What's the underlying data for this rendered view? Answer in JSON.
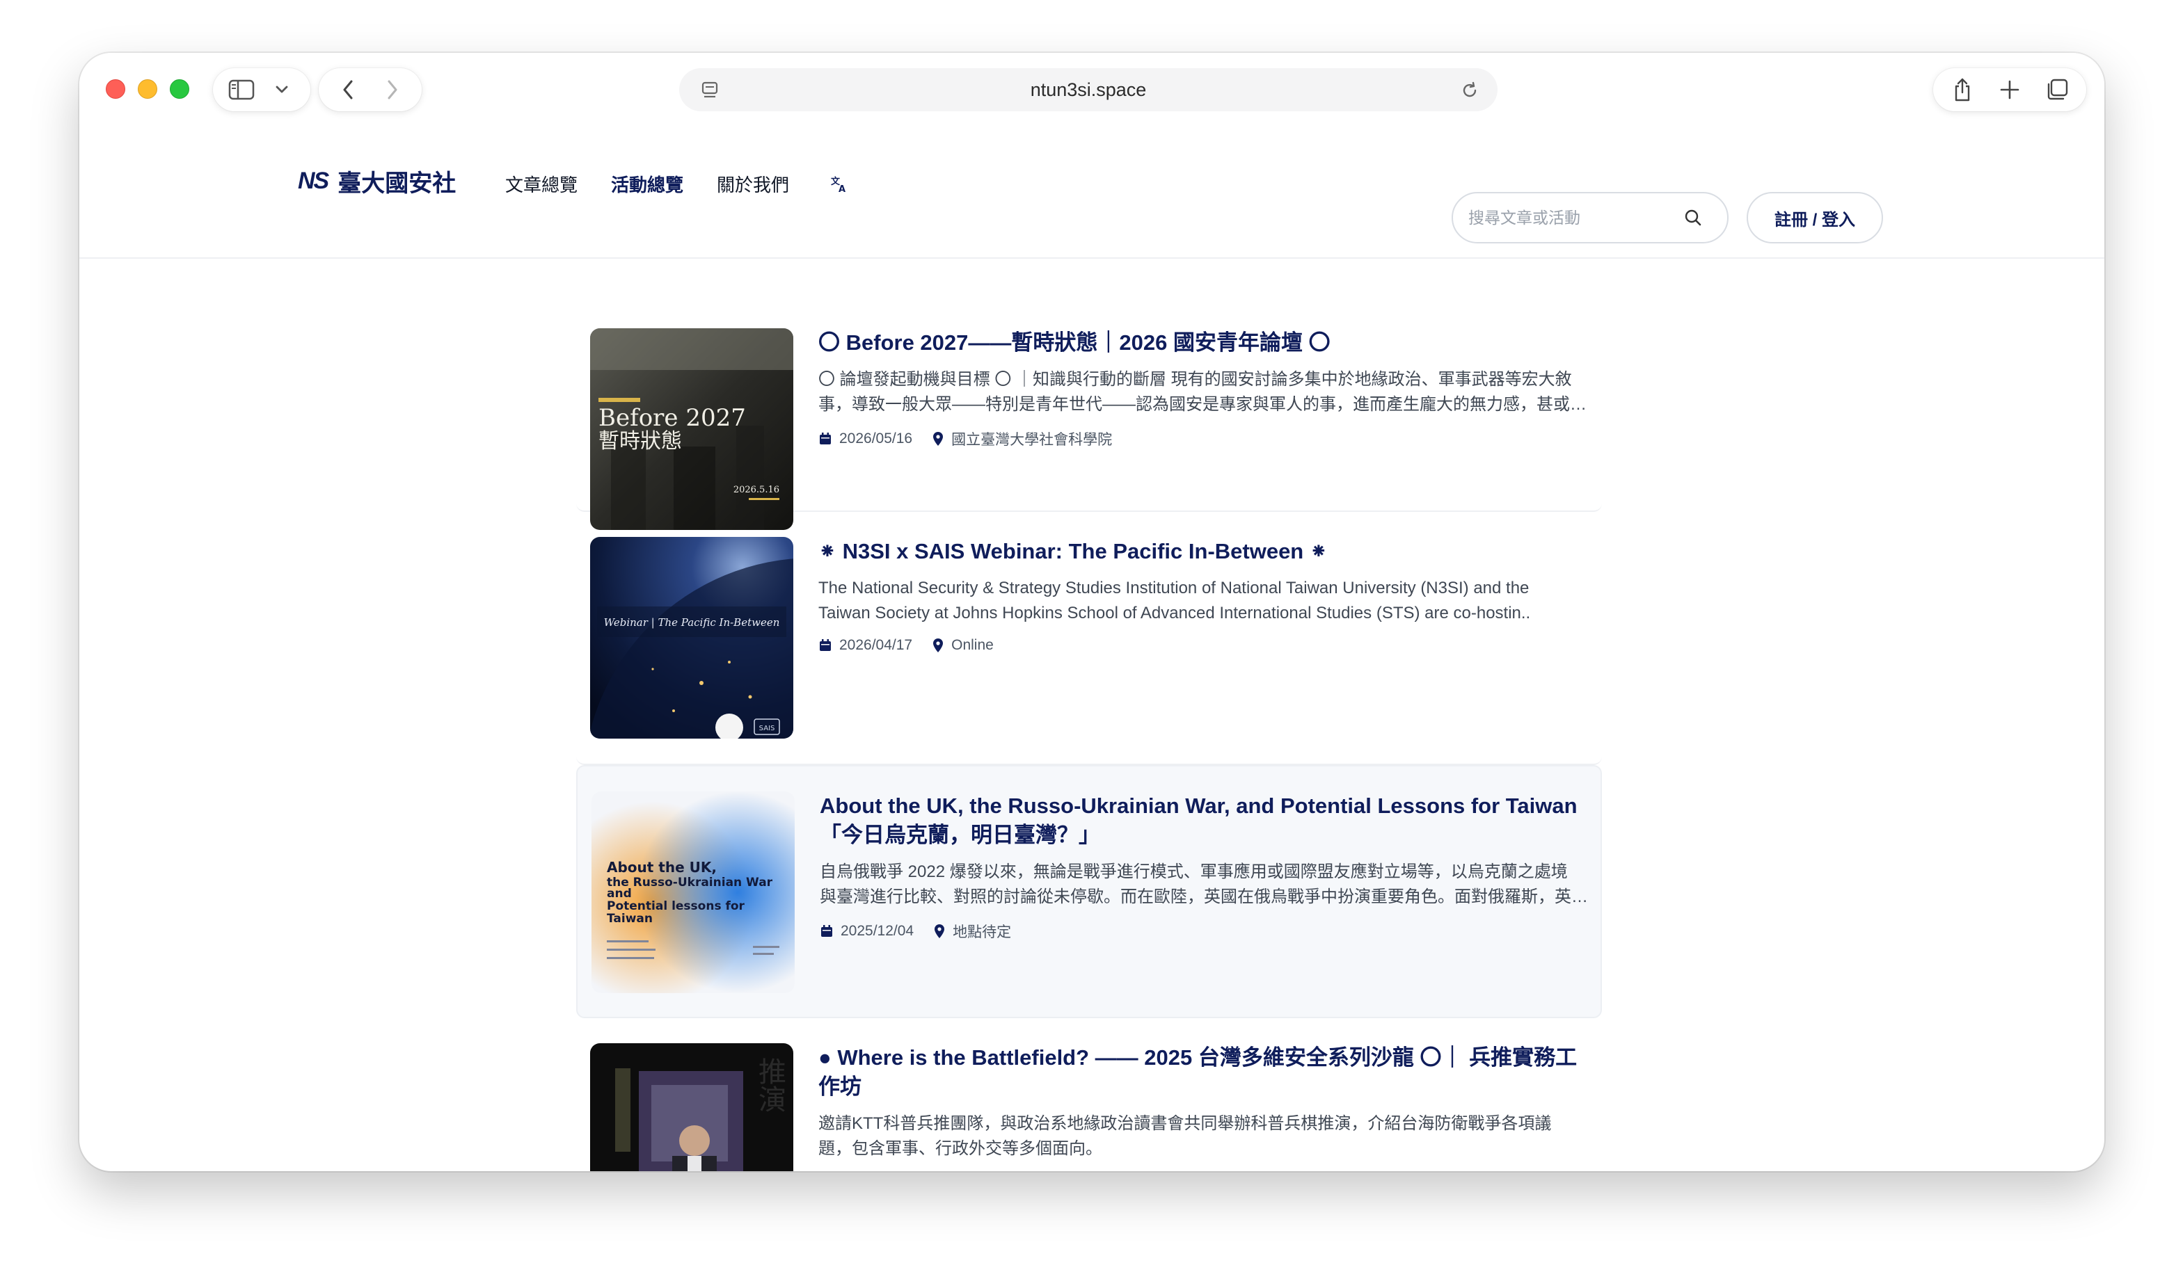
{
  "browser": {
    "url": "ntun3si.space"
  },
  "site": {
    "logo_mark": "NS",
    "logo_text": "臺大國安社",
    "nav": [
      "文章總覽",
      "活動總覽",
      "關於我們"
    ],
    "search_placeholder": "搜尋文章或活動",
    "login_label": "註冊 / 登入"
  },
  "events": [
    {
      "title": "〇 Before 2027——暫時狀態｜2026 國安青年論壇 〇",
      "desc": [
        "〇 論壇發起動機與目標 〇 ｜知識與行動的斷層 現有的國安討論多集中於地緣政治、軍事武器等宏大敘",
        "事，導致一般大眾——特別是青年世代——認為國安是專家與軍人的事，進而產生龐大的無力感，甚或…"
      ],
      "date": "2026/05/16",
      "location": "國立臺灣大學社會科學院",
      "thumb_text": [
        "Before 2027",
        "暫時狀態",
        "2026.5.16"
      ]
    },
    {
      "title": "⁕ N3SI x SAIS Webinar: The Pacific In-Between ⁕",
      "desc": [
        "The National Security & Strategy Studies Institution of National Taiwan University (N3SI) and the",
        "Taiwan Society at Johns Hopkins School of Advanced International Studies (STS) are co-hostin.."
      ],
      "date": "2026/04/17",
      "location": "Online",
      "thumb_text": [
        "Webinar | The Pacific In-Between",
        "SAIS"
      ]
    },
    {
      "title_lines": [
        "About the UK, the Russo-Ukrainian War, and Potential Lessons for Taiwan",
        "「今日烏克蘭，明日臺灣？」"
      ],
      "desc": [
        "自烏俄戰爭 2022 爆發以來，無論是戰爭進行模式、軍事應用或國際盟友應對立場等，以烏克蘭之處境",
        "與臺灣進行比較、對照的討論從未停歇。而在歐陸，英國在俄烏戰爭中扮演重要角色。面對俄羅斯，英…"
      ],
      "date": "2025/12/04",
      "location": "地點待定",
      "thumb_text": [
        "About the UK,",
        "the Russo-Ukrainian War",
        "and",
        "Potential lessons for",
        "Taiwan"
      ]
    },
    {
      "title_lines": [
        "● Where is the Battlefield? —— 2025 台灣多維安全系列沙龍 〇｜ 兵推實務工",
        "作坊"
      ],
      "desc": [
        "邀請KTT科普兵推團隊，與政治系地緣政治讀書會共同舉辦科普兵棋推演，介紹台海防衛戰爭各項議",
        "題，包含軍事、行政外交等多個面向。"
      ],
      "thumb_text": [
        "推演"
      ]
    }
  ]
}
